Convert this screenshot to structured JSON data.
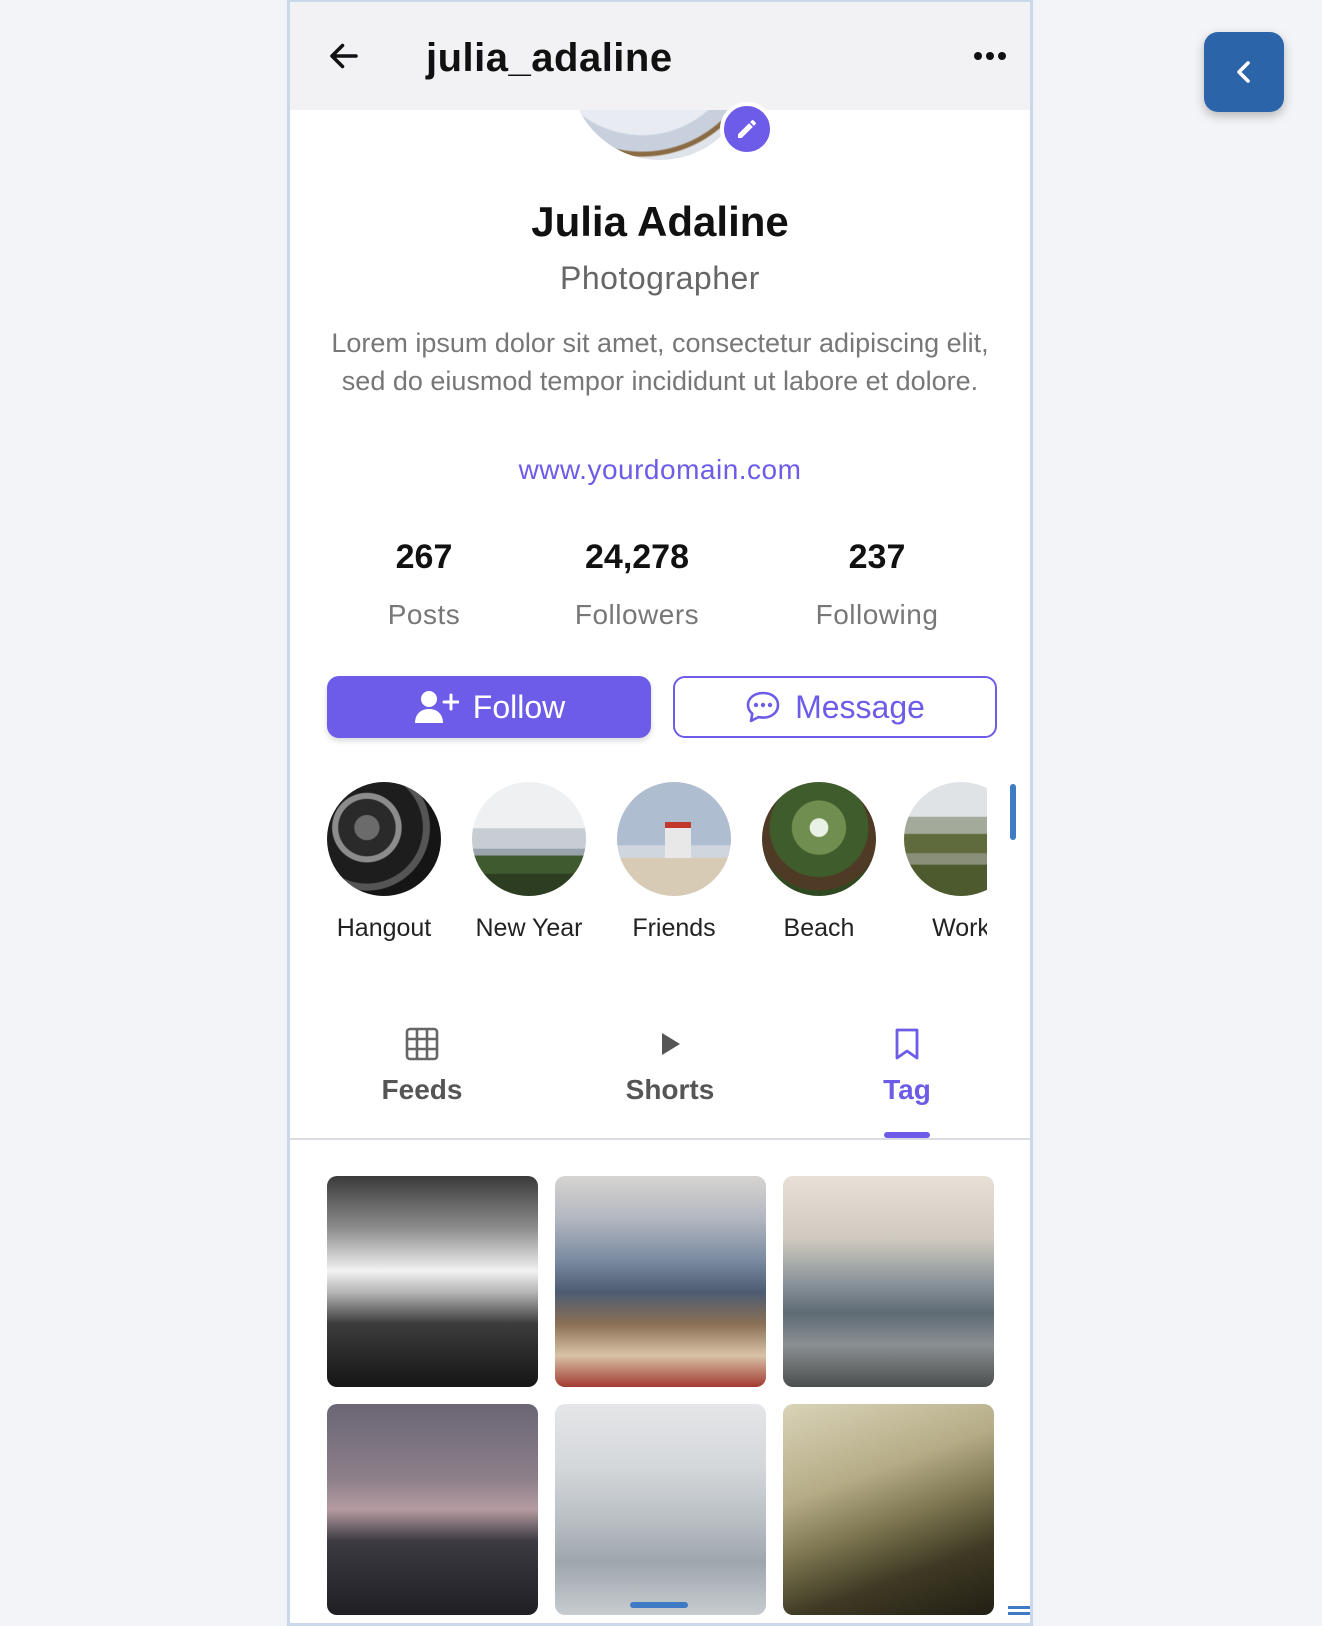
{
  "header": {
    "username": "julia_adaline",
    "back_icon": "arrow-left-icon",
    "more_icon": "more-horizontal-icon"
  },
  "profile": {
    "name": "Julia Adaline",
    "profession": "Photographer",
    "bio": "Lorem ipsum dolor sit amet, consectetur adipiscing elit, sed do eiusmod tempor incididunt ut labore et dolore.",
    "website": "www.yourdomain.com",
    "avatar_number": "4"
  },
  "stats": [
    {
      "value": "267",
      "label": "Posts"
    },
    {
      "value": "24,278",
      "label": "Followers"
    },
    {
      "value": "237",
      "label": "Following"
    }
  ],
  "actions": {
    "follow_label": "Follow",
    "message_label": "Message"
  },
  "highlights": [
    {
      "label": "Hangout"
    },
    {
      "label": "New Year"
    },
    {
      "label": "Friends"
    },
    {
      "label": "Beach"
    },
    {
      "label": "Work"
    }
  ],
  "tabs": [
    {
      "label": "Feeds",
      "icon": "grid-icon"
    },
    {
      "label": "Shorts",
      "icon": "play-icon"
    },
    {
      "label": "Tag",
      "icon": "bookmark-icon",
      "active": true
    }
  ],
  "colors": {
    "accent": "#6c5ce7",
    "side_button": "#2b64a8"
  }
}
